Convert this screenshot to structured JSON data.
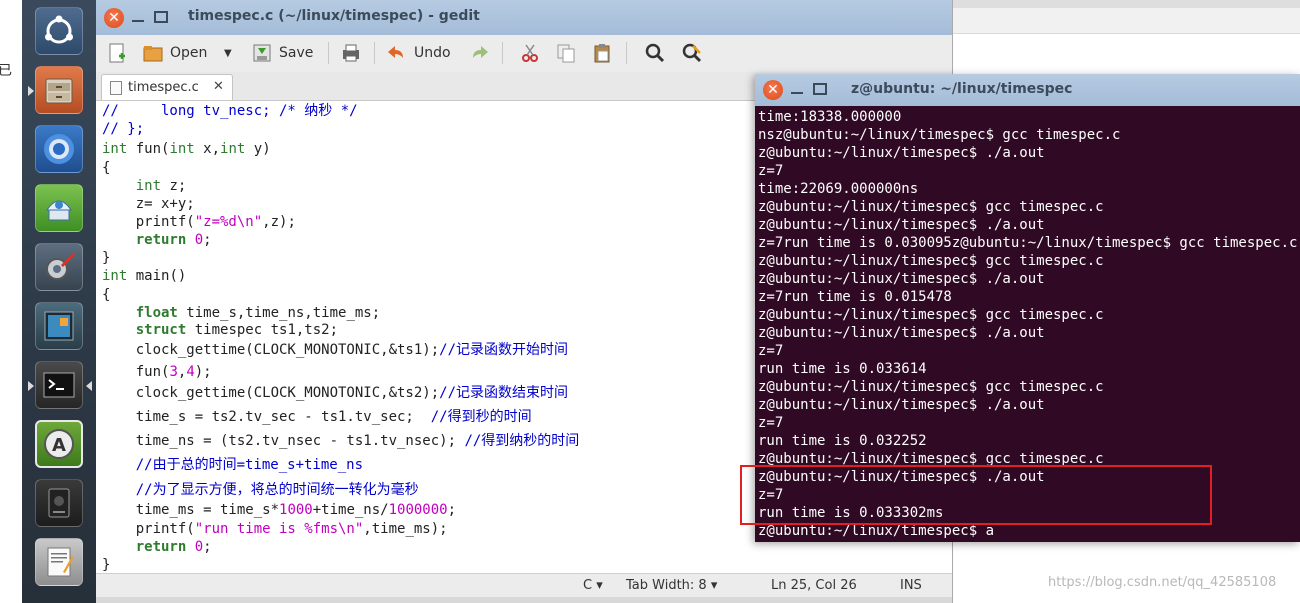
{
  "left_fragment": "已",
  "gedit": {
    "title": "timespec.c (~/linux/timespec) - gedit",
    "toolbar": {
      "open": "Open",
      "save": "Save",
      "undo": "Undo"
    },
    "tab_label": "timespec.c",
    "tab_close": "✕",
    "status": {
      "language": "C ▾",
      "tab_width": "Tab Width: 8 ▾",
      "position": "Ln 25, Col 26",
      "mode": "INS"
    }
  },
  "code_lines": [
    [
      {
        "t": "//     long tv_nesc; /* 纳秒 */",
        "c": "cm"
      }
    ],
    [
      {
        "t": "// };",
        "c": "cm"
      }
    ],
    [
      {
        "t": "int",
        "c": "ty"
      },
      {
        "t": " fun(",
        "c": ""
      },
      {
        "t": "int",
        "c": "ty"
      },
      {
        "t": " x,",
        "c": ""
      },
      {
        "t": "int",
        "c": "ty"
      },
      {
        "t": " y)",
        "c": ""
      }
    ],
    [
      {
        "t": "{",
        "c": ""
      }
    ],
    [
      {
        "t": "    ",
        "c": ""
      },
      {
        "t": "int",
        "c": "ty"
      },
      {
        "t": " z;",
        "c": ""
      }
    ],
    [
      {
        "t": "    z= x+y;",
        "c": ""
      }
    ],
    [
      {
        "t": "    printf(",
        "c": ""
      },
      {
        "t": "\"z=%d\\n\"",
        "c": "st"
      },
      {
        "t": ",z);",
        "c": ""
      }
    ],
    [
      {
        "t": "    ",
        "c": ""
      },
      {
        "t": "return",
        "c": "kw"
      },
      {
        "t": " ",
        "c": ""
      },
      {
        "t": "0",
        "c": "nu"
      },
      {
        "t": ";",
        "c": ""
      }
    ],
    [
      {
        "t": "}",
        "c": ""
      }
    ],
    [
      {
        "t": "int",
        "c": "ty"
      },
      {
        "t": " main()",
        "c": ""
      }
    ],
    [
      {
        "t": "{",
        "c": ""
      }
    ],
    [
      {
        "t": "    ",
        "c": ""
      },
      {
        "t": "float",
        "c": "kw"
      },
      {
        "t": " time_s,time_ns,time_ms;",
        "c": ""
      }
    ],
    [
      {
        "t": "    ",
        "c": ""
      },
      {
        "t": "struct",
        "c": "kw"
      },
      {
        "t": " timespec ts1,ts2;",
        "c": ""
      }
    ],
    [
      {
        "t": "    clock_gettime(CLOCK_MONOTONIC,&ts1);",
        "c": ""
      },
      {
        "t": "//记录函数开始时间",
        "c": "cm"
      }
    ],
    [
      {
        "t": "    fun(",
        "c": ""
      },
      {
        "t": "3",
        "c": "nu"
      },
      {
        "t": ",",
        "c": ""
      },
      {
        "t": "4",
        "c": "nu"
      },
      {
        "t": ");",
        "c": ""
      }
    ],
    [
      {
        "t": "    clock_gettime(CLOCK_MONOTONIC,&ts2);",
        "c": ""
      },
      {
        "t": "//记录函数结束时间",
        "c": "cm"
      }
    ],
    [
      {
        "t": "    time_s = ts2.tv_sec - ts1.tv_sec;  ",
        "c": ""
      },
      {
        "t": "//得到秒的时间",
        "c": "cm"
      }
    ],
    [
      {
        "t": "    time_ns = (ts2.tv_nsec - ts1.tv_nsec); ",
        "c": ""
      },
      {
        "t": "//得到纳秒的时间",
        "c": "cm"
      }
    ],
    [
      {
        "t": "    //由于总的时间=time_s+time_ns",
        "c": "cm"
      }
    ],
    [
      {
        "t": "    //为了显示方便，将总的时间统一转化为毫秒",
        "c": "cm"
      }
    ],
    [
      {
        "t": "    time_ms = time_s*",
        "c": ""
      },
      {
        "t": "1000",
        "c": "nu"
      },
      {
        "t": "+time_ns/",
        "c": ""
      },
      {
        "t": "1000000",
        "c": "nu"
      },
      {
        "t": ";",
        "c": ""
      }
    ],
    [
      {
        "t": "    printf(",
        "c": ""
      },
      {
        "t": "\"run time is %fms\\n\"",
        "c": "st"
      },
      {
        "t": ",time_ms);",
        "c": ""
      }
    ],
    [
      {
        "t": "    ",
        "c": ""
      },
      {
        "t": "return",
        "c": "kw"
      },
      {
        "t": " ",
        "c": ""
      },
      {
        "t": "0",
        "c": "nu"
      },
      {
        "t": ";",
        "c": ""
      }
    ],
    [
      {
        "t": "}",
        "c": ""
      }
    ]
  ],
  "terminal": {
    "title": "z@ubuntu: ~/linux/timespec",
    "lines": [
      "time:18338.000000",
      "nsz@ubuntu:~/linux/timespec$ gcc timespec.c",
      "z@ubuntu:~/linux/timespec$ ./a.out",
      "z=7",
      "time:22069.000000ns",
      "z@ubuntu:~/linux/timespec$ gcc timespec.c",
      "z@ubuntu:~/linux/timespec$ ./a.out",
      "z=7run time is 0.030095z@ubuntu:~/linux/timespec$ gcc timespec.c",
      "z@ubuntu:~/linux/timespec$ gcc timespec.c",
      "z@ubuntu:~/linux/timespec$ ./a.out",
      "z=7run time is 0.015478",
      "z@ubuntu:~/linux/timespec$ gcc timespec.c",
      "z@ubuntu:~/linux/timespec$ ./a.out",
      "z=7",
      "run time is 0.033614",
      "z@ubuntu:~/linux/timespec$ gcc timespec.c",
      "z@ubuntu:~/linux/timespec$ ./a.out",
      "z=7",
      "run time is 0.032252",
      "z@ubuntu:~/linux/timespec$ gcc timespec.c",
      "z@ubuntu:~/linux/timespec$ ./a.out",
      "z=7",
      "run time is 0.033302ms",
      "z@ubuntu:~/linux/timespec$ a"
    ]
  },
  "launcher": [
    {
      "name": "ubuntu-dash-icon"
    },
    {
      "name": "file-manager-icon"
    },
    {
      "name": "chromium-browser-icon"
    },
    {
      "name": "software-updater-icon"
    },
    {
      "name": "system-settings-icon"
    },
    {
      "name": "workspace-switcher-icon"
    },
    {
      "name": "terminal-icon"
    },
    {
      "name": "software-center-icon"
    },
    {
      "name": "storage-device-icon"
    },
    {
      "name": "text-editor-icon"
    }
  ],
  "watermark": "https://blog.csdn.net/qq_42585108",
  "colors": {
    "title_bar": "#b6cbe2",
    "terminal_bg": "#300a24",
    "launcher_bg": "#2c3845",
    "highlight_box": "#e02020",
    "comment": "#0000cc",
    "keyword": "#2e7b2e",
    "string": "#c000c0"
  }
}
